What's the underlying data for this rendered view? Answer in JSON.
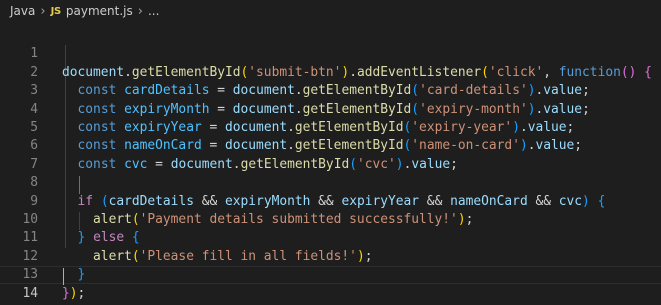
{
  "breadcrumb": {
    "folder": "Java",
    "file_badge": "JS",
    "file": "payment.js",
    "trail": "..."
  },
  "editor": {
    "active_line": 14,
    "lines": [
      {
        "num": "1"
      },
      {
        "num": "2"
      },
      {
        "num": "3"
      },
      {
        "num": "4"
      },
      {
        "num": "5"
      },
      {
        "num": "6"
      },
      {
        "num": "7"
      },
      {
        "num": "8"
      },
      {
        "num": "9"
      },
      {
        "num": "10"
      },
      {
        "num": "11"
      },
      {
        "num": "12"
      },
      {
        "num": "13"
      },
      {
        "num": "14"
      }
    ],
    "tokens": {
      "l1": [
        "document",
        ".",
        "getElementById",
        "(",
        "'submit-btn'",
        ")",
        ".",
        "addEventListener",
        "(",
        "'click'",
        ", ",
        "function",
        "() {"
      ],
      "l2": [
        "const",
        "cardDetails",
        " = ",
        "document",
        ".",
        "getElementById",
        "(",
        "'card-details'",
        ")",
        ".",
        "value",
        ";"
      ],
      "l3": [
        "const",
        "expiryMonth",
        " = ",
        "document",
        ".",
        "getElementById",
        "(",
        "'expiry-month'",
        ")",
        ".",
        "value",
        ";"
      ],
      "l4": [
        "const",
        "expiryYear",
        " = ",
        "document",
        ".",
        "getElementById",
        "(",
        "'expiry-year'",
        ")",
        ".",
        "value",
        ";"
      ],
      "l5": [
        "const",
        "nameOnCard",
        " = ",
        "document",
        ".",
        "getElementById",
        "(",
        "'name-on-card'",
        ")",
        ".",
        "value",
        ";"
      ],
      "l6": [
        "const",
        "cvc",
        " = ",
        "document",
        ".",
        "getElementById",
        "(",
        "'cvc'",
        ")",
        ".",
        "value",
        ";"
      ],
      "l8": [
        "if",
        " ",
        "(",
        "cardDetails",
        " && ",
        "expiryMonth",
        " && ",
        "expiryYear",
        " && ",
        "nameOnCard",
        " && ",
        "cvc",
        ")",
        " {"
      ],
      "l9": [
        "alert",
        "(",
        "'Payment details submitted successfully!'",
        ")",
        ";"
      ],
      "l10": [
        "}",
        " ",
        "else",
        " ",
        "{"
      ],
      "l11": [
        "alert",
        "(",
        "'Please fill in all fields!'",
        ")",
        ";"
      ],
      "l12": [
        "}"
      ],
      "l13": [
        "}",
        ")",
        ";"
      ]
    }
  },
  "colors": {
    "background": "#1e1e1e",
    "keyword": "#569cd6",
    "control": "#c586c0",
    "function": "#dcdcaa",
    "string": "#ce9178",
    "variable": "#9cdcfe"
  }
}
